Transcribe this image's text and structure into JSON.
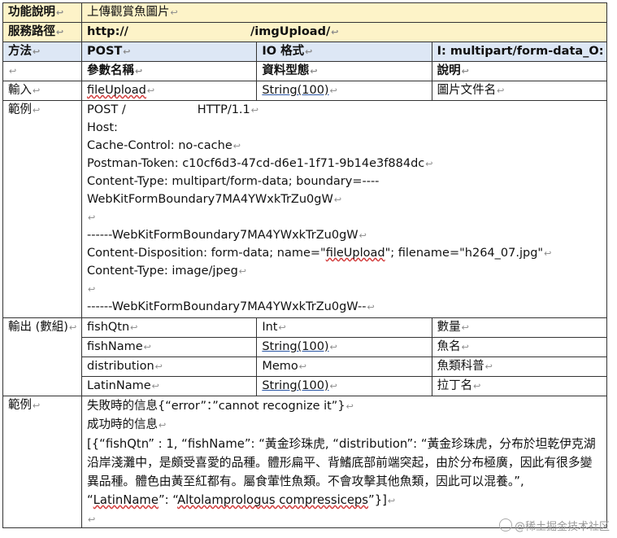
{
  "mark": "↩",
  "rows": {
    "function_label": "功能說明",
    "function_value": "上傳觀賞魚圖片",
    "path_label": "服務路徑",
    "path_prefix": "http://",
    "path_suffix": "/imgUpload/",
    "method_label": "方法",
    "method_value": "POST",
    "io_label": "IO 格式",
    "io_value": "I: multipart/form-data_O: JSON",
    "param_name_header": "參數名稱",
    "data_type_header": "資料型態",
    "desc_header": "說明",
    "input_label": "輸入",
    "input_param": "fileUpload",
    "input_type": "String(100)",
    "input_desc": "圖片文件名"
  },
  "example1": {
    "label": "範例",
    "lines": [
      "POST /",
      "HTTP/1.1",
      "Host:",
      "Cache-Control: no-cache",
      "Postman-Token: c10cf6d3-47cd-d6e1-1f71-9b14e3f884dc",
      "Content-Type: multipart/form-data; boundary=----",
      "WebKitFormBoundary7MA4YWxkTrZu0gW",
      "------WebKitFormBoundary7MA4YWxkTrZu0gW",
      "Content-Disposition: form-data; name=\"",
      "fileUpload",
      "\"; filename=\"h264_07.jpg\"",
      "Content-Type: image/jpeg",
      "------WebKitFormBoundary7MA4YWxkTrZu0gW--"
    ]
  },
  "output": {
    "label": "輸出 (數組)",
    "rows": [
      {
        "name": "fishQtn",
        "type": "Int",
        "desc": "數量"
      },
      {
        "name": "fishName",
        "type": "String(100)",
        "desc": "魚名"
      },
      {
        "name": "distribution",
        "type": "Memo",
        "desc": "魚類科普"
      },
      {
        "name": "LatinName",
        "type": "String(100)",
        "desc": "拉丁名"
      }
    ]
  },
  "example2": {
    "label": "範例",
    "fail": "失敗時的信息{“error”：”cannot recognize it”}",
    "success_label": "成功時的信息",
    "json_text_1": "[{“fishQtn” : 1, “fishName”: “黃金珍珠虎, “distribution”: “黃金珍珠虎，分布於坦乾伊克湖沿岸淺灘中，是頗受喜愛的品種。體形扁平、背鰭底部前端突起，由於分布極廣，因此有很多變異品種。體色由黃至紅都有。屬食葷性魚類。不會攻擊其他魚類，因此可以混養。”, “",
    "json_latin_key": "LatinName",
    "json_text_2": "”: “",
    "json_latin_value": "Altolamprologus compressiceps",
    "json_text_3": "”}]"
  },
  "watermark": "@稀土掘金技术社区"
}
